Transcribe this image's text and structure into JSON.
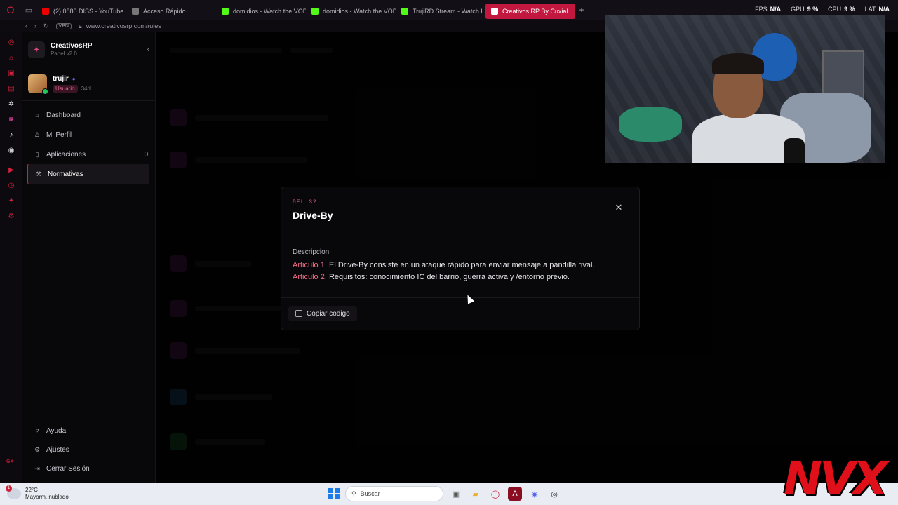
{
  "browser": {
    "tabs": [
      {
        "label": "(2) 0880 DISS - YouTube",
        "color": "#e00"
      },
      {
        "label": "Acceso Rápido",
        "color": "#777"
      },
      {
        "label": "domidios - Watch the VOD",
        "color": "#53fc18"
      },
      {
        "label": "domidios - Watch the VOD",
        "color": "#53fc18"
      },
      {
        "label": "TrujiRD Stream - Watch L",
        "color": "#53fc18"
      },
      {
        "label": "Creativos RP By Cuxial",
        "color": "#ffffff"
      }
    ],
    "vpn_label": "VPN",
    "url": "www.creativosrp.com/rules"
  },
  "stream_stats": [
    {
      "label": "FPS",
      "value": "N/A"
    },
    {
      "label": "GPU",
      "value": "9 %"
    },
    {
      "label": "CPU",
      "value": "9 %"
    },
    {
      "label": "LAT",
      "value": "N/A"
    }
  ],
  "sidebar": {
    "brand_name": "CreativosRP",
    "brand_sub": "Panel v2.0",
    "user": {
      "name": "trujir",
      "role": "Usuario",
      "age": "34d"
    },
    "items": [
      {
        "label": "Dashboard",
        "icon": "home-icon",
        "count": ""
      },
      {
        "label": "Mi Perfil",
        "icon": "user-icon",
        "count": ""
      },
      {
        "label": "Aplicaciones",
        "icon": "document-icon",
        "count": "0"
      },
      {
        "label": "Normativas",
        "icon": "gavel-icon",
        "count": ""
      }
    ],
    "bottom_items": [
      {
        "label": "Ayuda",
        "icon": "help-icon"
      },
      {
        "label": "Ajustes",
        "icon": "gear-icon"
      },
      {
        "label": "Cerrar Sesión",
        "icon": "logout-icon"
      }
    ]
  },
  "modal": {
    "kicker": "DEL 32",
    "title": "Drive-By",
    "description_label": "Descripcion",
    "articles": [
      {
        "tag": "Articulo 1.",
        "text": " El Drive-By consiste en un ataque rápido para enviar mensaje a pandilla rival."
      },
      {
        "tag": "Articulo 2.",
        "text": " Requisitos: conocimiento IC del barrio, guerra activa y /entorno previo."
      }
    ],
    "copy_label": "Copiar codigo"
  },
  "overlay_logo": "NVX",
  "taskbar": {
    "temperature": "22°C",
    "weather": "Mayorm. nublado",
    "search_placeholder": "Buscar"
  },
  "colors": {
    "accent": "#d0213c",
    "article_tag": "#ef6b82"
  }
}
